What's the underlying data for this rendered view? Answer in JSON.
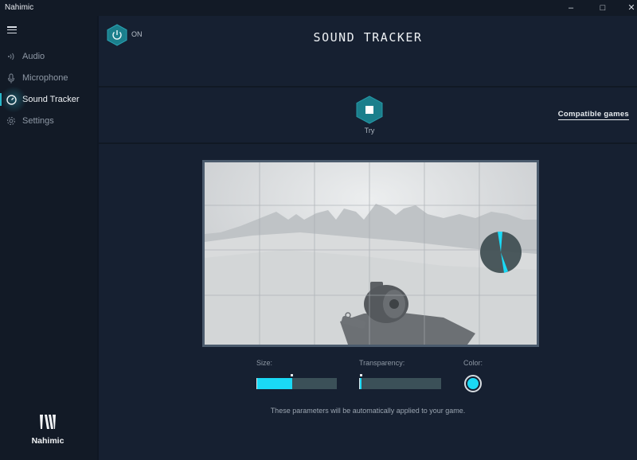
{
  "window": {
    "title": "Nahimic",
    "minimize_icon": "–",
    "maximize_icon": "□",
    "close_icon": "✕"
  },
  "sidebar": {
    "items": [
      {
        "label": "Audio",
        "icon": "audio-waves-icon",
        "active": false
      },
      {
        "label": "Microphone",
        "icon": "microphone-icon",
        "active": false
      },
      {
        "label": "Sound Tracker",
        "icon": "radar-icon",
        "active": true
      },
      {
        "label": "Settings",
        "icon": "gear-icon",
        "active": false
      }
    ],
    "logo_text": "Nahimic"
  },
  "header": {
    "power_state": "ON",
    "title": "SOUND TRACKER"
  },
  "try": {
    "label": "Try",
    "icon": "stop-icon"
  },
  "compatible_games_link": "Compatible games",
  "preview": {
    "description": "Sound tracker overlay preview on game scene",
    "radar_color": "#1ad9f5"
  },
  "controls": {
    "size": {
      "label": "Size:",
      "value_percent": 45
    },
    "transparency": {
      "label": "Transparency:",
      "value_percent": 3
    },
    "color": {
      "label": "Color:",
      "value": "#1ad9f5"
    }
  },
  "footnote": "These parameters will be automatically applied to your game.",
  "colors": {
    "accent": "#1ad9f5",
    "hex_button": "#1b7f8c",
    "background": "#162031",
    "sidebar": "#121a26"
  }
}
